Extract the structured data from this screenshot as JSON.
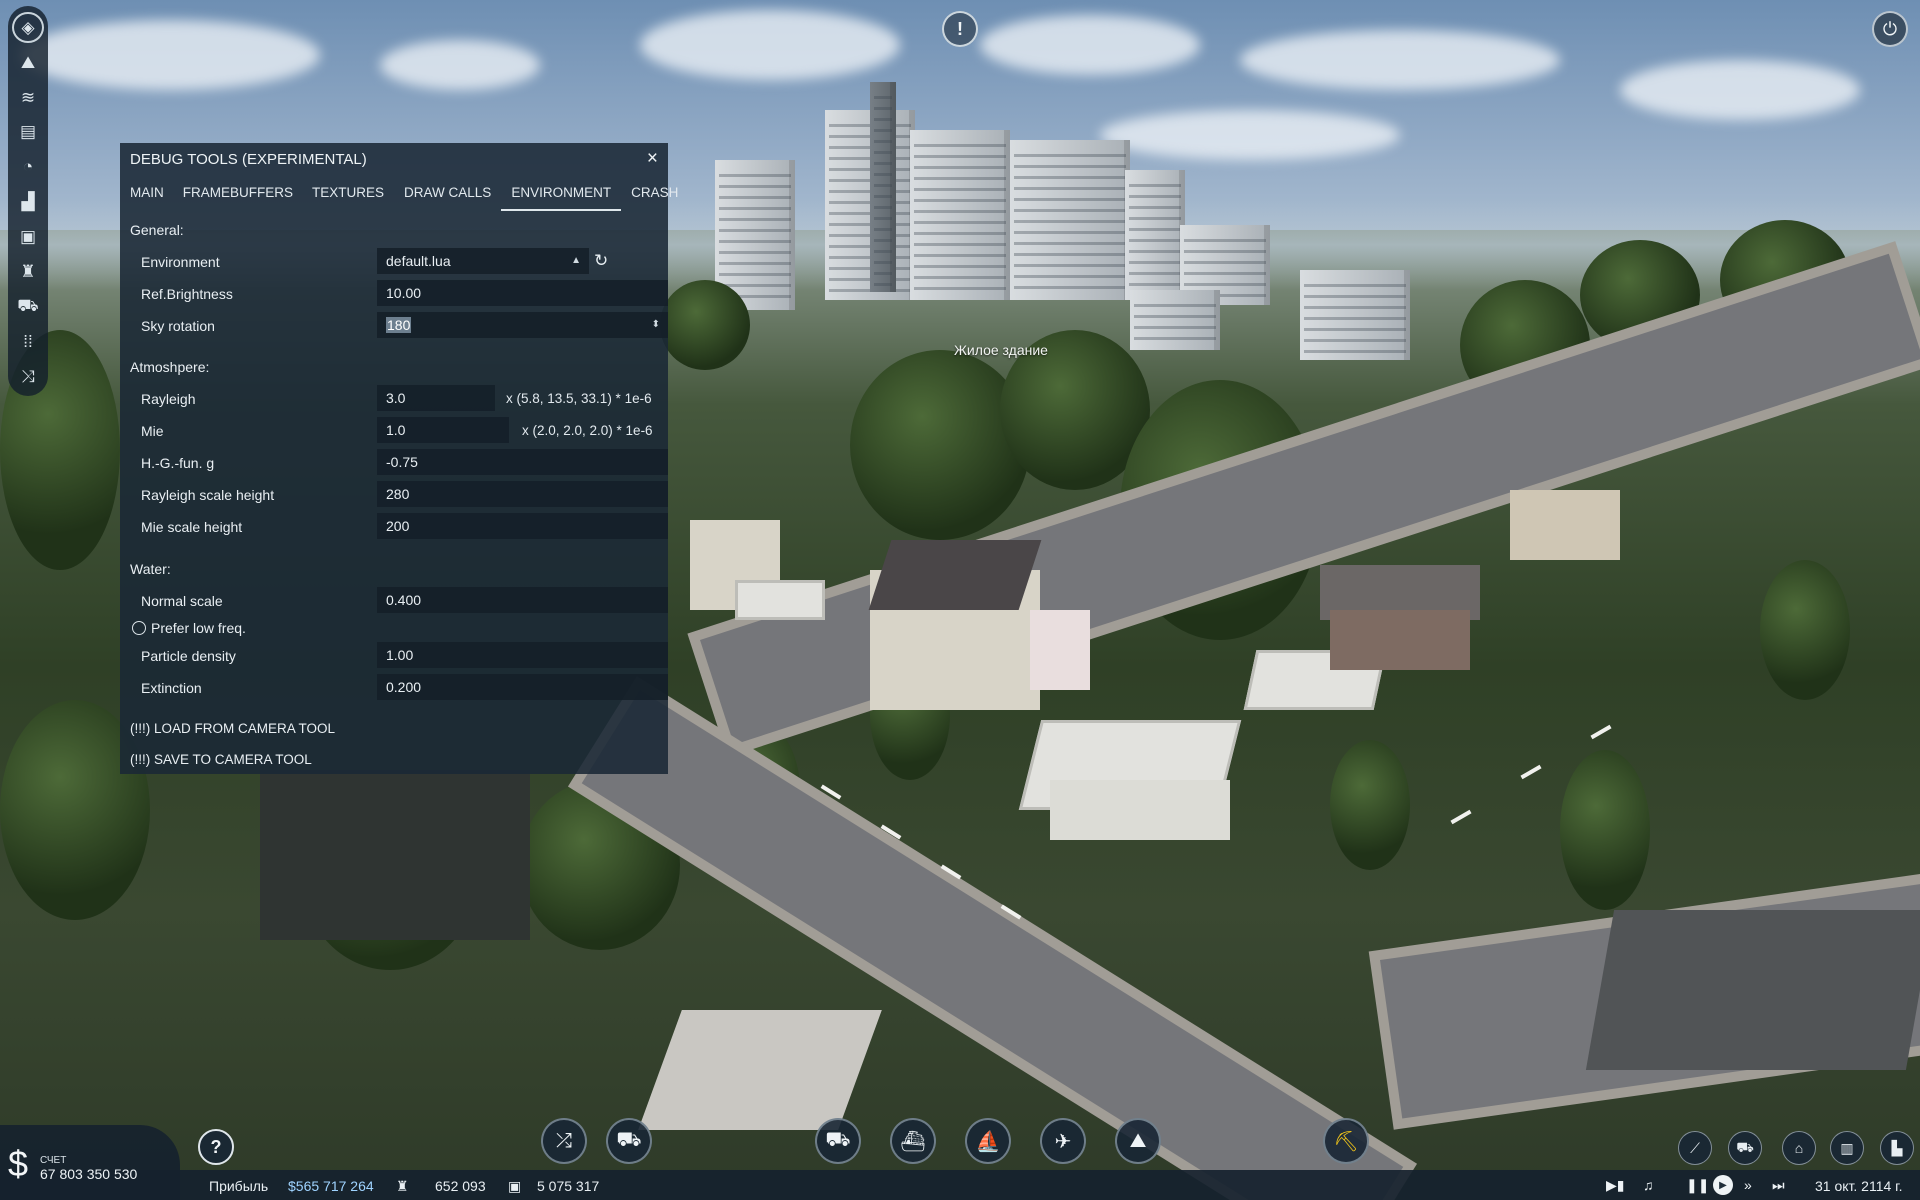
{
  "debug_panel": {
    "title": "DEBUG TOOLS (EXPERIMENTAL)",
    "close_icon": "×",
    "tabs": [
      {
        "label": "MAIN",
        "active": false
      },
      {
        "label": "FRAMEBUFFERS",
        "active": false
      },
      {
        "label": "TEXTURES",
        "active": false
      },
      {
        "label": "DRAW CALLS",
        "active": false
      },
      {
        "label": "ENVIRONMENT",
        "active": true
      },
      {
        "label": "CRASH",
        "active": false
      }
    ],
    "general": {
      "heading": "General:",
      "environment": {
        "label": "Environment",
        "value": "default.lua"
      },
      "ref_brightness": {
        "label": "Ref.Brightness",
        "value": "10.00"
      },
      "sky_rotation": {
        "label": "Sky rotation",
        "value": "180"
      }
    },
    "atmosphere": {
      "heading": "Atmoshpere:",
      "rayleigh": {
        "label": "Rayleigh",
        "value": "3.0",
        "suffix": "x (5.8, 13.5, 33.1) * 1e-6"
      },
      "mie": {
        "label": "Mie",
        "value": "1.0",
        "suffix": "x (2.0, 2.0, 2.0) * 1e-6"
      },
      "hg_fun": {
        "label": "H.-G.-fun. g",
        "value": "-0.75"
      },
      "rayleigh_scale": {
        "label": "Rayleigh scale height",
        "value": "280"
      },
      "mie_scale": {
        "label": "Mie scale height",
        "value": "200"
      }
    },
    "water": {
      "heading": "Water:",
      "normal_scale": {
        "label": "Normal scale",
        "value": "0.400"
      },
      "prefer_low_freq": {
        "label": "Prefer low freq.",
        "checked": false
      },
      "particle_density": {
        "label": "Particle density",
        "value": "1.00"
      },
      "extinction": {
        "label": "Extinction",
        "value": "0.200"
      }
    },
    "actions": {
      "load": "(!!!) LOAD FROM CAMERA TOOL",
      "save": "(!!!) SAVE TO CAMERA TOOL"
    }
  },
  "world": {
    "hover_label": "Жилое здание",
    "alert_glyph": "!"
  },
  "left_toolbar": {
    "icons": [
      "layers-icon",
      "terrain-icon",
      "water-icon",
      "finance-icon",
      "speed-icon",
      "town-icon",
      "cargo-icon",
      "company-icon",
      "vehicles-icon",
      "audio-icon",
      "routes-icon"
    ]
  },
  "hud": {
    "account_label": "СЧЕТ",
    "account_value": "67 803 350 530",
    "profit_label": "Прибыль",
    "profit_value": "$565 717 264",
    "population_value": "652 093",
    "cargo_value": "5 075 317",
    "date": "31 окт. 2114 г.",
    "help_glyph": "?",
    "dollar_glyph": "$",
    "center_buttons": [
      "line-manager-icon",
      "vehicle-manager-icon",
      "road-vehicle-icon",
      "train-icon",
      "ship-icon",
      "airplane-icon",
      "terraform-icon",
      "bulldozer-icon"
    ],
    "right_buttons": [
      "track-icon",
      "depot-icon",
      "station-icon",
      "town-view-icon",
      "industry-icon",
      "factory-icon"
    ],
    "accent_color": "#f0c419"
  }
}
